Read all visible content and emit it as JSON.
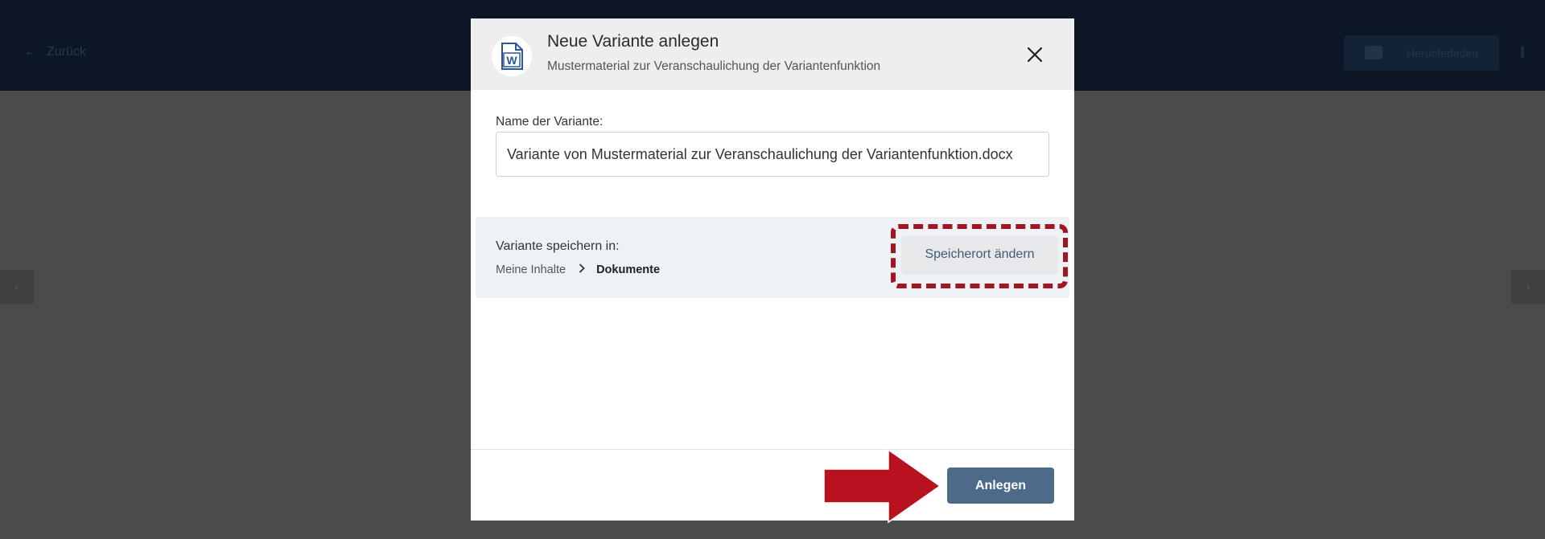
{
  "background": {
    "back_label": "Zurück",
    "header_button_label": "Herunterladen"
  },
  "modal": {
    "title": "Neue Variante anlegen",
    "subtitle": "Mustermaterial zur Veranschaulichung der Variantenfunktion",
    "doc_icon": "word-document-icon",
    "close_icon": "close-icon",
    "name_label": "Name der Variante:",
    "name_value": "Variante von Mustermaterial zur Veranschaulichung der Variantenfunktion.docx",
    "save_in_label": "Variante speichern in:",
    "breadcrumb": [
      "Meine Inhalte",
      "Dokumente"
    ],
    "change_location_label": "Speicherort ändern",
    "create_label": "Anlegen"
  },
  "colors": {
    "highlight": "#a01622",
    "primary_button": "#4d6a88",
    "word_blue": "#2b579a"
  }
}
